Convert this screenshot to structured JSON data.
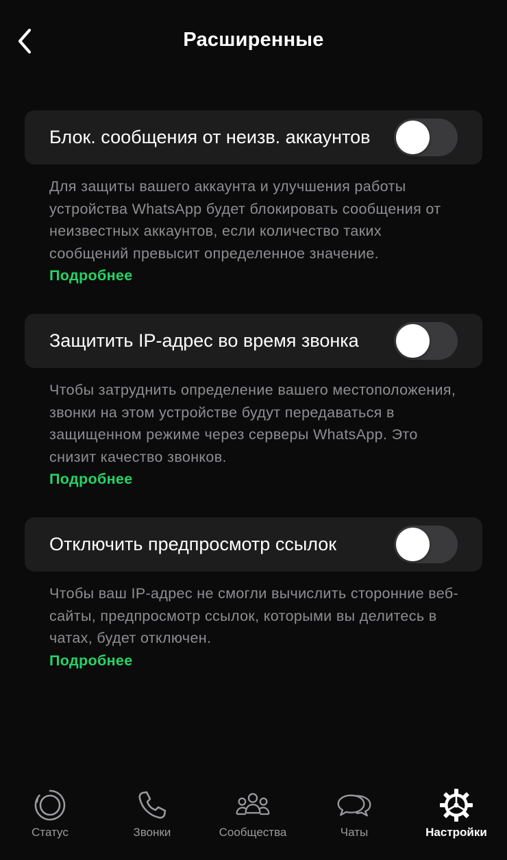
{
  "header": {
    "title": "Расширенные",
    "back_icon": "chevron-left-icon"
  },
  "settings": [
    {
      "label": "Блок. сообщения от неизв. аккаунтов",
      "enabled": false,
      "description": "Для защиты вашего аккаунта и улучшения работы устройства WhatsApp будет блокировать сообщения от неизвестных аккаунтов, если количество таких сообщений превысит определенное значение.",
      "link": "Подробнее"
    },
    {
      "label": "Защитить IP-адрес во время звонка",
      "enabled": false,
      "description": "Чтобы затруднить определение вашего местоположения, звонки на этом устройстве будут передаваться в защищенном режиме через серверы WhatsApp. Это снизит качество звонков.",
      "link": "Подробнее"
    },
    {
      "label": "Отключить предпросмотр ссылок",
      "enabled": false,
      "description": "Чтобы ваш IP-адрес не смогли вычислить сторонние веб-сайты, предпросмотр ссылок, которыми вы делитесь в чатах, будет отключен.",
      "link": "Подробнее"
    }
  ],
  "tabbar": {
    "tabs": [
      {
        "label": "Статус",
        "icon": "status-icon",
        "active": false
      },
      {
        "label": "Звонки",
        "icon": "phone-icon",
        "active": false
      },
      {
        "label": "Сообщества",
        "icon": "communities-icon",
        "active": false
      },
      {
        "label": "Чаты",
        "icon": "chats-icon",
        "active": false
      },
      {
        "label": "Настройки",
        "icon": "gear-icon",
        "active": true
      }
    ]
  },
  "colors": {
    "background": "#0b0b0b",
    "row_background": "#1d1d1e",
    "toggle_off": "#3a3a3c",
    "link_green": "#25d366",
    "secondary_text": "#8e8e93"
  }
}
